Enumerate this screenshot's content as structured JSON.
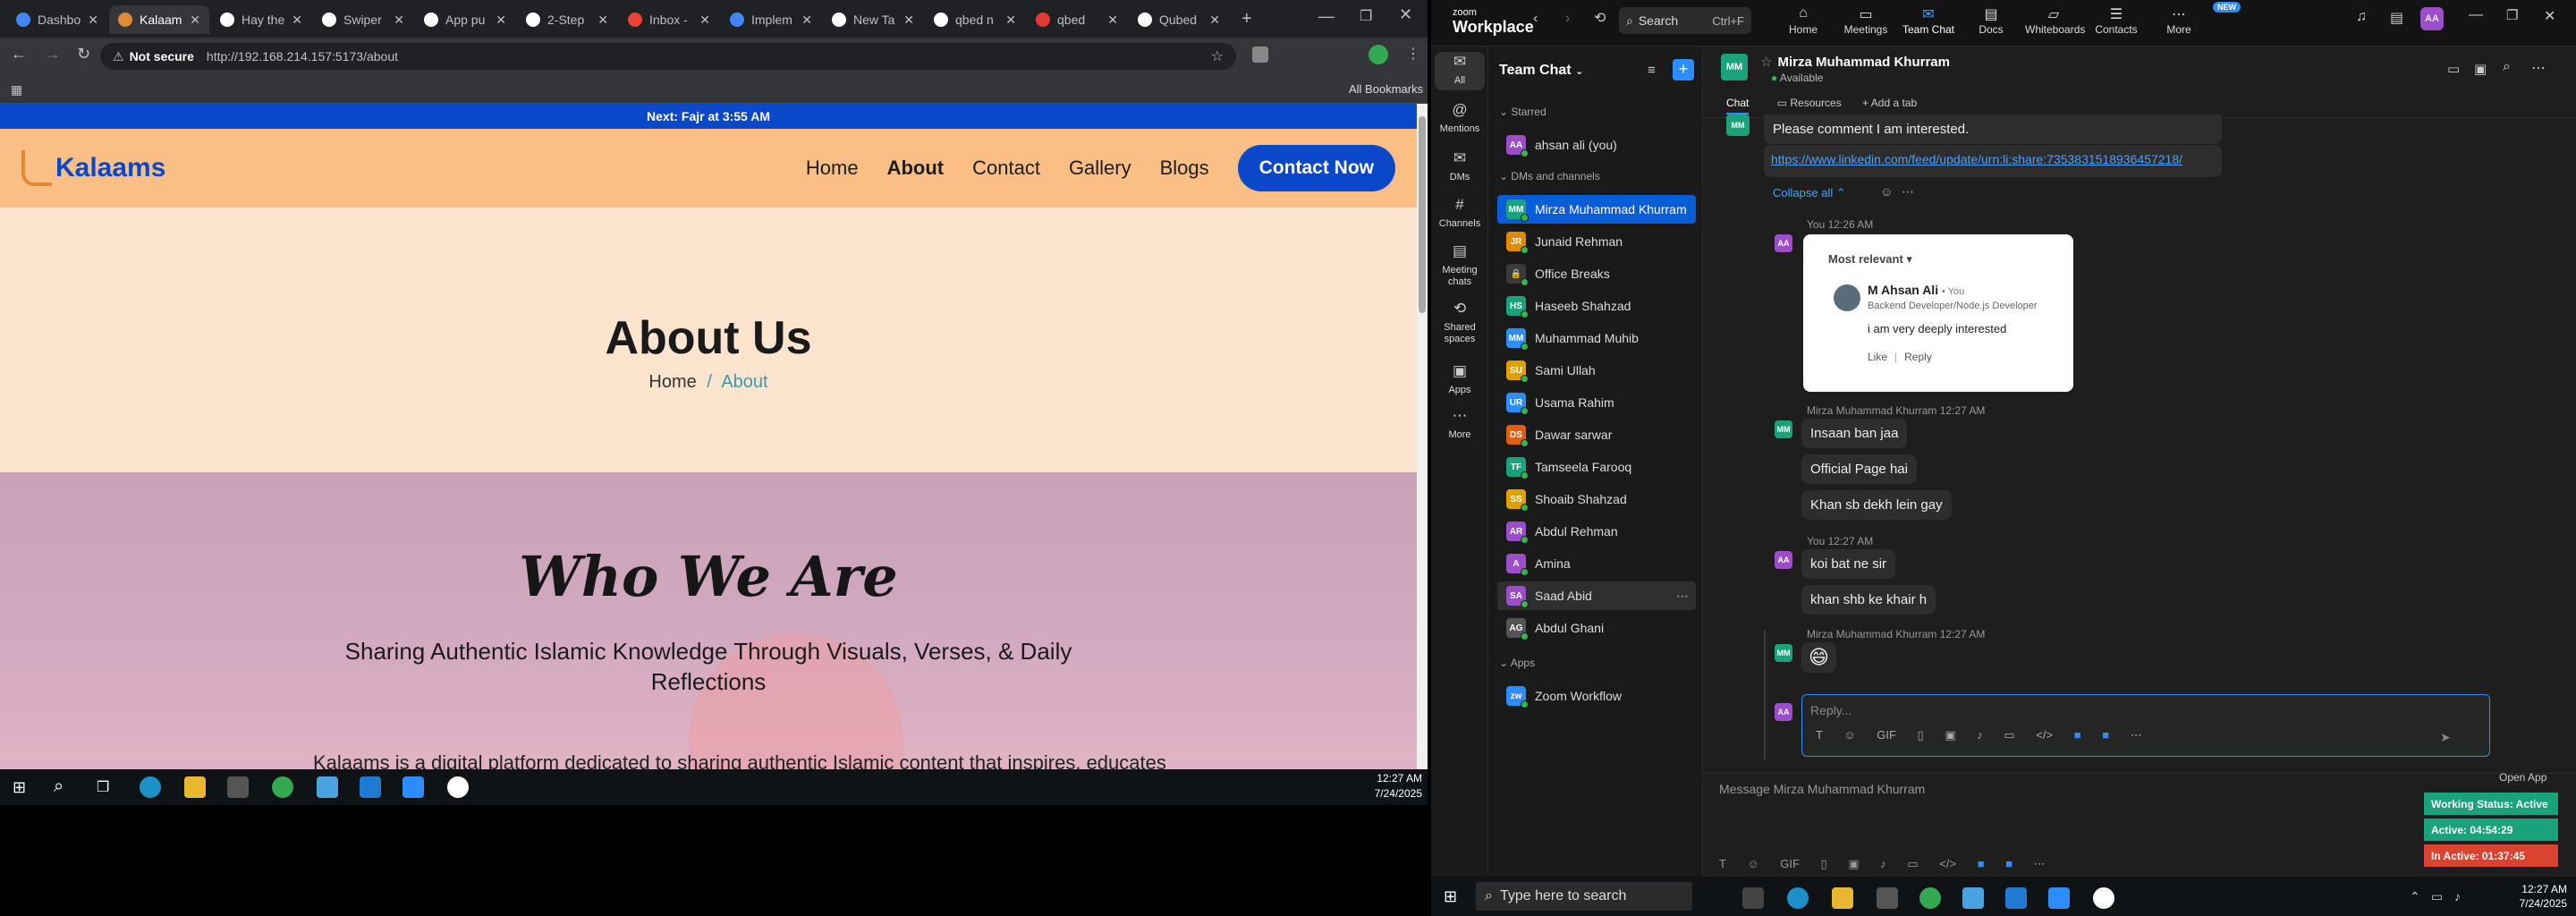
{
  "browser": {
    "tabs": [
      {
        "title": "Dashbo",
        "active": false,
        "color": "#4285f4"
      },
      {
        "title": "Kalaam",
        "active": true,
        "color": "#e08a35"
      },
      {
        "title": "Hay the",
        "active": false,
        "color": "#ffffff"
      },
      {
        "title": "Swiper",
        "active": false,
        "color": "#ffffff"
      },
      {
        "title": "App pu",
        "active": false,
        "color": "#ffffff"
      },
      {
        "title": "2-Step",
        "active": false,
        "color": "#ffffff"
      },
      {
        "title": "Inbox -",
        "active": false,
        "color": "#ea4335"
      },
      {
        "title": "Implem",
        "active": false,
        "color": "#4285f4"
      },
      {
        "title": "New Ta",
        "active": false,
        "color": "#ffffff"
      },
      {
        "title": "qbed n",
        "active": false,
        "color": "#ffffff"
      },
      {
        "title": "qbed",
        "active": false,
        "color": "#e53935"
      },
      {
        "title": "Qubed",
        "active": false,
        "color": "#ffffff"
      }
    ],
    "not_secure": "Not secure",
    "url": "http://192.168.214.157:5173/about",
    "all_bookmarks": "All Bookmarks"
  },
  "site": {
    "prayer_banner": "Next: Fajr at 3:55 AM",
    "logo": "Kalaams",
    "nav": [
      "Home",
      "About",
      "Contact",
      "Gallery",
      "Blogs"
    ],
    "cta": "Contact Now",
    "about_title": "About Us",
    "crumb_home": "Home",
    "crumb_sep": "/",
    "crumb_current": "About",
    "who_title": "Who We Are",
    "who_subtitle": "Sharing Authentic Islamic Knowledge Through Visuals, Verses, & Daily Reflections",
    "who_cut_text": "Kalaams is a digital platform dedicated to sharing authentic Islamic content that inspires, educates"
  },
  "left_clock": {
    "time": "12:27 AM",
    "date": "7/24/2025"
  },
  "zoom": {
    "brand_small": "zoom",
    "brand": "Workplace",
    "search": "Search",
    "search_key": "Ctrl+F",
    "top_tabs": [
      "Home",
      "Meetings",
      "Team Chat",
      "Docs",
      "Whiteboards",
      "Contacts",
      "More"
    ],
    "new_badge": "NEW",
    "side": [
      "All",
      "Mentions",
      "DMs",
      "Channels",
      "Meeting chats",
      "Shared spaces",
      "Apps",
      "More"
    ],
    "list_title": "Team Chat",
    "starred": "Starred",
    "starred_item": "ahsan ali (you)",
    "dms_header": "DMs and channels",
    "contacts": [
      {
        "name": "Mirza Muhammad Khurram",
        "ini": "MM",
        "color": "#1aa37a"
      },
      {
        "name": "Junaid Rehman",
        "ini": "JR",
        "color": "#e08a00"
      },
      {
        "name": "Office Breaks",
        "ini": "🔒",
        "color": "#3a3a3a"
      },
      {
        "name": "Haseeb Shahzad",
        "ini": "HS",
        "color": "#1aa37a"
      },
      {
        "name": "Muhammad Muhib",
        "ini": "MM",
        "color": "#2d8cff"
      },
      {
        "name": "Sami Ullah",
        "ini": "SU",
        "color": "#e0a000"
      },
      {
        "name": "Usama Rahim",
        "ini": "UR",
        "color": "#2d8cff"
      },
      {
        "name": "Dawar sarwar",
        "ini": "DS",
        "color": "#e06010"
      },
      {
        "name": "Tamseela Farooq",
        "ini": "TF",
        "color": "#1aa37a"
      },
      {
        "name": "Shoaib Shahzad",
        "ini": "SS",
        "color": "#e0a000"
      },
      {
        "name": "Abdul Rehman",
        "ini": "AR",
        "color": "#9b4dca"
      },
      {
        "name": "Amina",
        "ini": "A",
        "color": "#9b4dca"
      },
      {
        "name": "Saad Abid",
        "ini": "SA",
        "color": "#9b4dca"
      },
      {
        "name": "Abdul Ghani",
        "ini": "AG",
        "color": "#555555"
      }
    ],
    "apps_header": "Apps",
    "app_item": "Zoom Workflow",
    "chat_name": "Mirza Muhammad Khurram",
    "chat_status": "Available",
    "chat_tab": "Chat",
    "resources": "Resources",
    "add_tab": "Add a tab",
    "msgs": {
      "top_text": "Please comment I am interested.",
      "link": "https://www.linkedin.com/feed/update/urn:li:share:7353831518936457218/",
      "collapse": "Collapse all",
      "you1_meta": "You 12:26 AM",
      "card_sort": "Most relevant",
      "card_name": "M Ahsan Ali",
      "card_you": "• You",
      "card_role": "Backend Developer/Node.js Developer",
      "card_comment": "i am very deeply interested",
      "card_like": "Like",
      "card_reply": "Reply",
      "mm1_meta": "Mirza Muhammad Khurram 12:27 AM",
      "mm1": [
        "Insaan ban jaa",
        "Official Page hai",
        "Khan sb dekh lein gay"
      ],
      "you2_meta": "You 12:27 AM",
      "you2": [
        "koi bat ne sir",
        "khan shb ke khair h"
      ],
      "mm2_meta": "Mirza Muhammad Khurram 12:27 AM",
      "emoji": "😄"
    },
    "reply_ph": "Reply...",
    "msg_ph": "Message Mirza Muhammad Khurram",
    "open_app": "Open App",
    "status": [
      {
        "text": "Working Status: Active",
        "color": "#1aa37a"
      },
      {
        "text": "Active: 04:54:29",
        "color": "#1aa37a"
      },
      {
        "text": "In Active: 01:37:45",
        "color": "#d9432f"
      }
    ]
  },
  "win": {
    "search": "Type here to search",
    "time": "12:27 AM",
    "date": "7/24/2025"
  }
}
